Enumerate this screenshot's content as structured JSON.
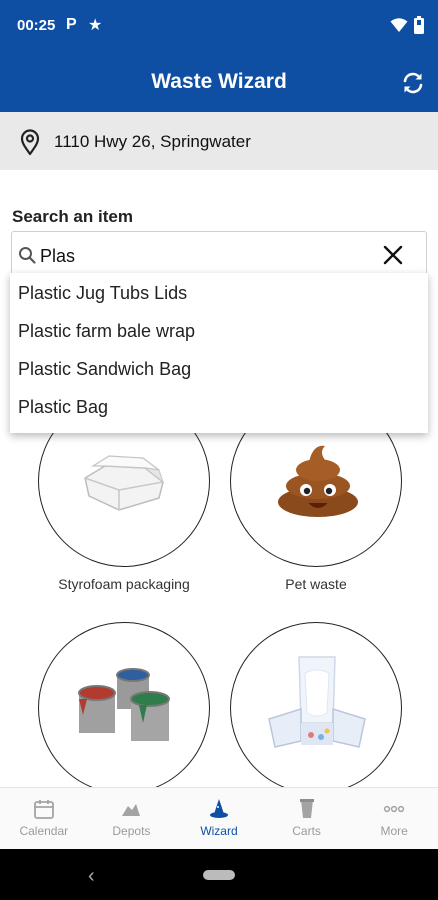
{
  "status_bar": {
    "time": "00:25",
    "left_icons": [
      "parking-icon",
      "star-icon"
    ],
    "right_icons": [
      "wifi-icon",
      "battery-icon"
    ]
  },
  "app_bar": {
    "title": "Waste Wizard",
    "refresh_icon": "refresh-icon",
    "color": "#0f4fa3"
  },
  "address": {
    "icon": "location-pin-icon",
    "text": "1110 Hwy 26, Springwater"
  },
  "search": {
    "label": "Search an item",
    "value": "Plas",
    "suggestions": [
      "Plastic Jug Tubs Lids",
      "Plastic farm bale wrap",
      "Plastic Sandwich Bag",
      "Plastic Bag"
    ]
  },
  "items": [
    {
      "label": "Styrofoam packaging",
      "icon": "styrofoam-container-image"
    },
    {
      "label": "Pet waste",
      "icon": "poop-emoji-image"
    },
    {
      "label": "",
      "icon": "paint-cans-image"
    },
    {
      "label": "",
      "icon": "diaper-image"
    }
  ],
  "bottom_nav": {
    "items": [
      {
        "label": "Calendar",
        "icon": "calendar-icon"
      },
      {
        "label": "Depots",
        "icon": "depot-icon"
      },
      {
        "label": "Wizard",
        "icon": "wizard-icon"
      },
      {
        "label": "Carts",
        "icon": "cart-icon"
      },
      {
        "label": "More",
        "icon": "more-dots-icon"
      }
    ],
    "active": "Wizard",
    "active_color": "#0f4fa3"
  }
}
